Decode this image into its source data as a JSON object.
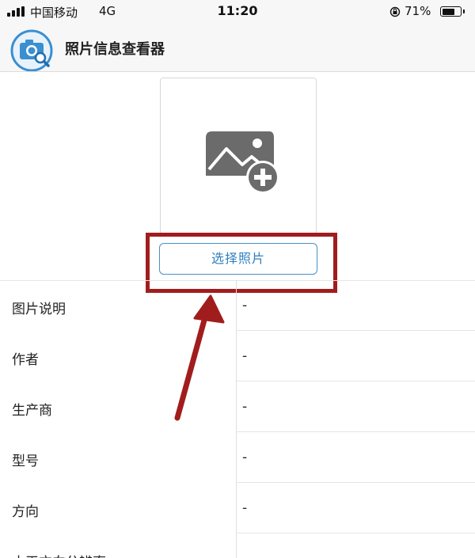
{
  "status_bar": {
    "carrier": "中国移动",
    "network": "4G",
    "time": "11:20",
    "battery_percent": "71%",
    "battery_level": 0.71
  },
  "header": {
    "title": "照片信息查看器",
    "logo_icon": "camera-search-icon"
  },
  "upload": {
    "icon": "add-photo-icon",
    "button_label": "选择照片"
  },
  "info_rows": [
    {
      "label": "图片说明",
      "value": "-"
    },
    {
      "label": "作者",
      "value": "-"
    },
    {
      "label": "生产商",
      "value": "-"
    },
    {
      "label": "型号",
      "value": "-"
    },
    {
      "label": "方向",
      "value": "-"
    },
    {
      "label": "水平方向分辨率",
      "value": "-"
    }
  ],
  "colors": {
    "accent": "#2f7fc0",
    "annotation": "#a11d1d",
    "icon_gray": "#6b6b6b"
  }
}
